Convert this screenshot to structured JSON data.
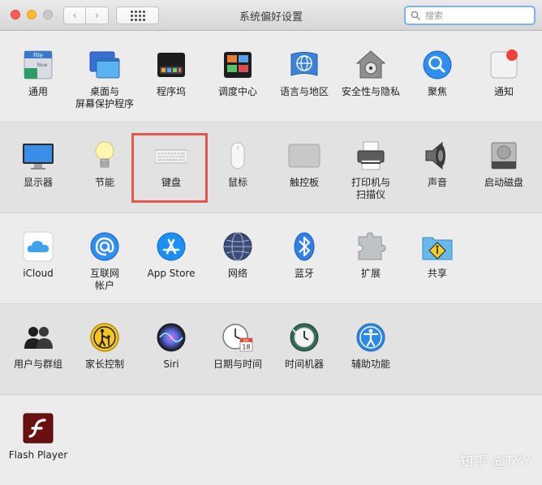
{
  "window": {
    "title": "系统偏好设置"
  },
  "search": {
    "placeholder": "搜索"
  },
  "toolbar": {
    "back": "‹",
    "forward": "›"
  },
  "rows": {
    "r1": [
      {
        "id": "general",
        "label": "通用",
        "icon": "general-icon"
      },
      {
        "id": "desktop",
        "label": "桌面与\n屏幕保护程序",
        "icon": "desktop-screensaver-icon"
      },
      {
        "id": "dock",
        "label": "程序坞",
        "icon": "dock-icon"
      },
      {
        "id": "mission",
        "label": "调度中心",
        "icon": "mission-control-icon"
      },
      {
        "id": "language",
        "label": "语言与地区",
        "icon": "language-region-icon"
      },
      {
        "id": "security",
        "label": "安全性与隐私",
        "icon": "security-privacy-icon"
      },
      {
        "id": "spotlight",
        "label": "聚焦",
        "icon": "spotlight-icon"
      },
      {
        "id": "notifications",
        "label": "通知",
        "icon": "notifications-icon"
      }
    ],
    "r2": [
      {
        "id": "displays",
        "label": "显示器",
        "icon": "display-icon"
      },
      {
        "id": "energy",
        "label": "节能",
        "icon": "energy-saver-icon"
      },
      {
        "id": "keyboard",
        "label": "键盘",
        "icon": "keyboard-icon"
      },
      {
        "id": "mouse",
        "label": "鼠标",
        "icon": "mouse-icon"
      },
      {
        "id": "trackpad",
        "label": "触控板",
        "icon": "trackpad-icon"
      },
      {
        "id": "printers",
        "label": "打印机与\n扫描仪",
        "icon": "printer-icon"
      },
      {
        "id": "sound",
        "label": "声音",
        "icon": "sound-icon"
      },
      {
        "id": "startup",
        "label": "启动磁盘",
        "icon": "startup-disk-icon"
      }
    ],
    "r3": [
      {
        "id": "icloud",
        "label": "iCloud",
        "icon": "icloud-icon"
      },
      {
        "id": "internet",
        "label": "互联网\n帐户",
        "icon": "internet-accounts-icon"
      },
      {
        "id": "appstore",
        "label": "App Store",
        "icon": "app-store-icon"
      },
      {
        "id": "network",
        "label": "网络",
        "icon": "network-icon"
      },
      {
        "id": "bluetooth",
        "label": "蓝牙",
        "icon": "bluetooth-icon"
      },
      {
        "id": "extensions",
        "label": "扩展",
        "icon": "extensions-icon"
      },
      {
        "id": "sharing",
        "label": "共享",
        "icon": "sharing-icon"
      }
    ],
    "r4": [
      {
        "id": "users",
        "label": "用户与群组",
        "icon": "users-groups-icon"
      },
      {
        "id": "parental",
        "label": "家长控制",
        "icon": "parental-controls-icon"
      },
      {
        "id": "siri",
        "label": "Siri",
        "icon": "siri-icon"
      },
      {
        "id": "datetime",
        "label": "日期与时间",
        "icon": "date-time-icon"
      },
      {
        "id": "timemachine",
        "label": "时间机器",
        "icon": "time-machine-icon"
      },
      {
        "id": "accessibility",
        "label": "辅助功能",
        "icon": "accessibility-icon"
      }
    ],
    "r5": [
      {
        "id": "flash",
        "label": "Flash Player",
        "icon": "flash-player-icon"
      }
    ]
  },
  "icon_text": {
    "general_file": "File",
    "general_new": "New",
    "calendar_month": "JUL",
    "calendar_day": "18"
  },
  "watermark": "知乎 @TYY",
  "colors": {
    "highlight": "#e4574d",
    "search_focus": "#7fb1f2"
  }
}
